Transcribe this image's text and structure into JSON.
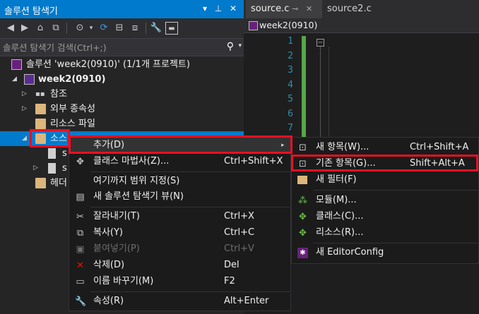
{
  "solution_explorer": {
    "title": "솔루션 탐색기",
    "search_placeholder": "솔루션 탐색기 검색(Ctrl+;)",
    "tree": {
      "solution": "솔루션 'week2(0910)' (1/1개 프로젝트)",
      "project": "week2(0910)",
      "references": "참조",
      "external_deps": "외부 종속성",
      "resource_files": "리소스 파일",
      "source_files": "소스",
      "child1": "s",
      "child2": "s",
      "header_files": "헤더"
    }
  },
  "editor": {
    "tab_active": "source.c",
    "tab_other": "source2.c",
    "nav_scope": "week2(0910)",
    "line_numbers": [
      "1",
      "2",
      "3",
      "4",
      "5",
      "6",
      "7"
    ],
    "collapse_glyph": "−"
  },
  "context_menu": {
    "items": [
      {
        "label": "추가(D)",
        "shortcut": "",
        "icon": "none",
        "submenu_arrow": "▸"
      },
      {
        "label": "클래스 마법사(Z)...",
        "shortcut": "Ctrl+Shift+X",
        "icon": "class-wizard-icon"
      },
      {
        "label": "여기까지 범위 지정(S)",
        "shortcut": "",
        "icon": "none"
      },
      {
        "label": "새 솔루션 탐색기 뷰(N)",
        "shortcut": "",
        "icon": "new-view-icon"
      },
      {
        "label": "잘라내기(T)",
        "shortcut": "Ctrl+X",
        "icon": "scissors-icon"
      },
      {
        "label": "복사(Y)",
        "shortcut": "Ctrl+C",
        "icon": "copy-icon"
      },
      {
        "label": "붙여넣기(P)",
        "shortcut": "Ctrl+V",
        "icon": "paste-icon"
      },
      {
        "label": "삭제(D)",
        "shortcut": "Del",
        "icon": "delete-icon"
      },
      {
        "label": "이름 바꾸기(M)",
        "shortcut": "F2",
        "icon": "rename-icon"
      },
      {
        "label": "속성(R)",
        "shortcut": "Alt+Enter",
        "icon": "wrench-icon"
      }
    ]
  },
  "submenu": {
    "items": [
      {
        "label": "새 항목(W)...",
        "shortcut": "Ctrl+Shift+A"
      },
      {
        "label": "기존 항목(G)...",
        "shortcut": "Shift+Alt+A"
      },
      {
        "label": "새 필터(F)",
        "shortcut": ""
      },
      {
        "label": "모듈(M)...",
        "shortcut": ""
      },
      {
        "label": "클래스(C)...",
        "shortcut": ""
      },
      {
        "label": "리소스(R)...",
        "shortcut": ""
      },
      {
        "label": "새 EditorConfig",
        "shortcut": ""
      }
    ]
  },
  "colors": {
    "accent": "#007acc",
    "highlight_box": "#e81123",
    "line_number": "#2b91af",
    "change_bar": "#57a64a"
  }
}
